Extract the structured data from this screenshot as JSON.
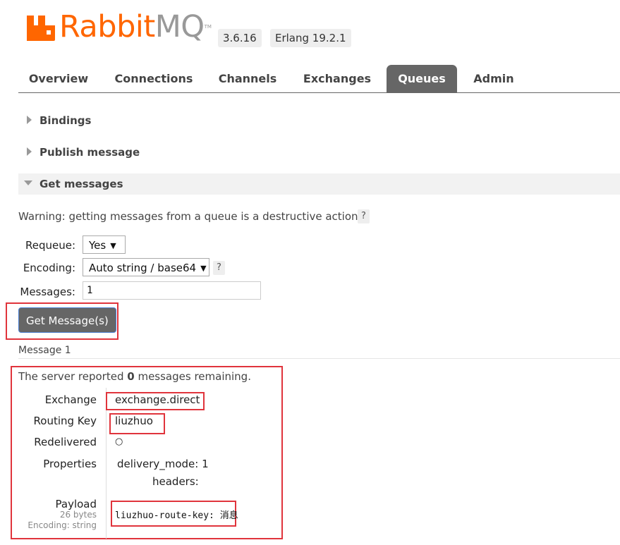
{
  "header": {
    "logo_text_rabbit": "Rabbit",
    "logo_text_mq": "MQ",
    "logo_tm": "TM",
    "version": "3.6.16",
    "erlang": "Erlang 19.2.1"
  },
  "tabs": [
    {
      "label": "Overview",
      "active": false
    },
    {
      "label": "Connections",
      "active": false
    },
    {
      "label": "Channels",
      "active": false
    },
    {
      "label": "Exchanges",
      "active": false
    },
    {
      "label": "Queues",
      "active": true
    },
    {
      "label": "Admin",
      "active": false
    }
  ],
  "sections": {
    "bindings": "Bindings",
    "publish": "Publish message",
    "get": "Get messages"
  },
  "get_messages": {
    "warning": "Warning: getting messages from a queue is a destructive action.",
    "help": "?",
    "requeue_label": "Requeue:",
    "requeue_value": "Yes",
    "encoding_label": "Encoding:",
    "encoding_value": "Auto string / base64",
    "messages_label": "Messages:",
    "messages_value": "1",
    "button": "Get Message(s)"
  },
  "result": {
    "title": "Message 1",
    "remaining_prefix": "The server reported ",
    "remaining_count": "0",
    "remaining_suffix": " messages remaining.",
    "exchange_label": "Exchange",
    "exchange_value": "exchange.direct",
    "routing_key_label": "Routing Key",
    "routing_key_value": "liuzhuo",
    "redelivered_label": "Redelivered",
    "redelivered_value": "○",
    "properties_label": "Properties",
    "delivery_mode_key": "delivery_mode:",
    "delivery_mode_value": "1",
    "headers_key": "headers:",
    "payload_label": "Payload",
    "payload_size": "26 bytes",
    "payload_encoding": "Encoding: string",
    "payload_value": "liuzhuo-route-key: 消息"
  },
  "colors": {
    "brand_orange": "#ff6600",
    "tab_active": "#666666",
    "highlight_red": "#e0343c"
  }
}
